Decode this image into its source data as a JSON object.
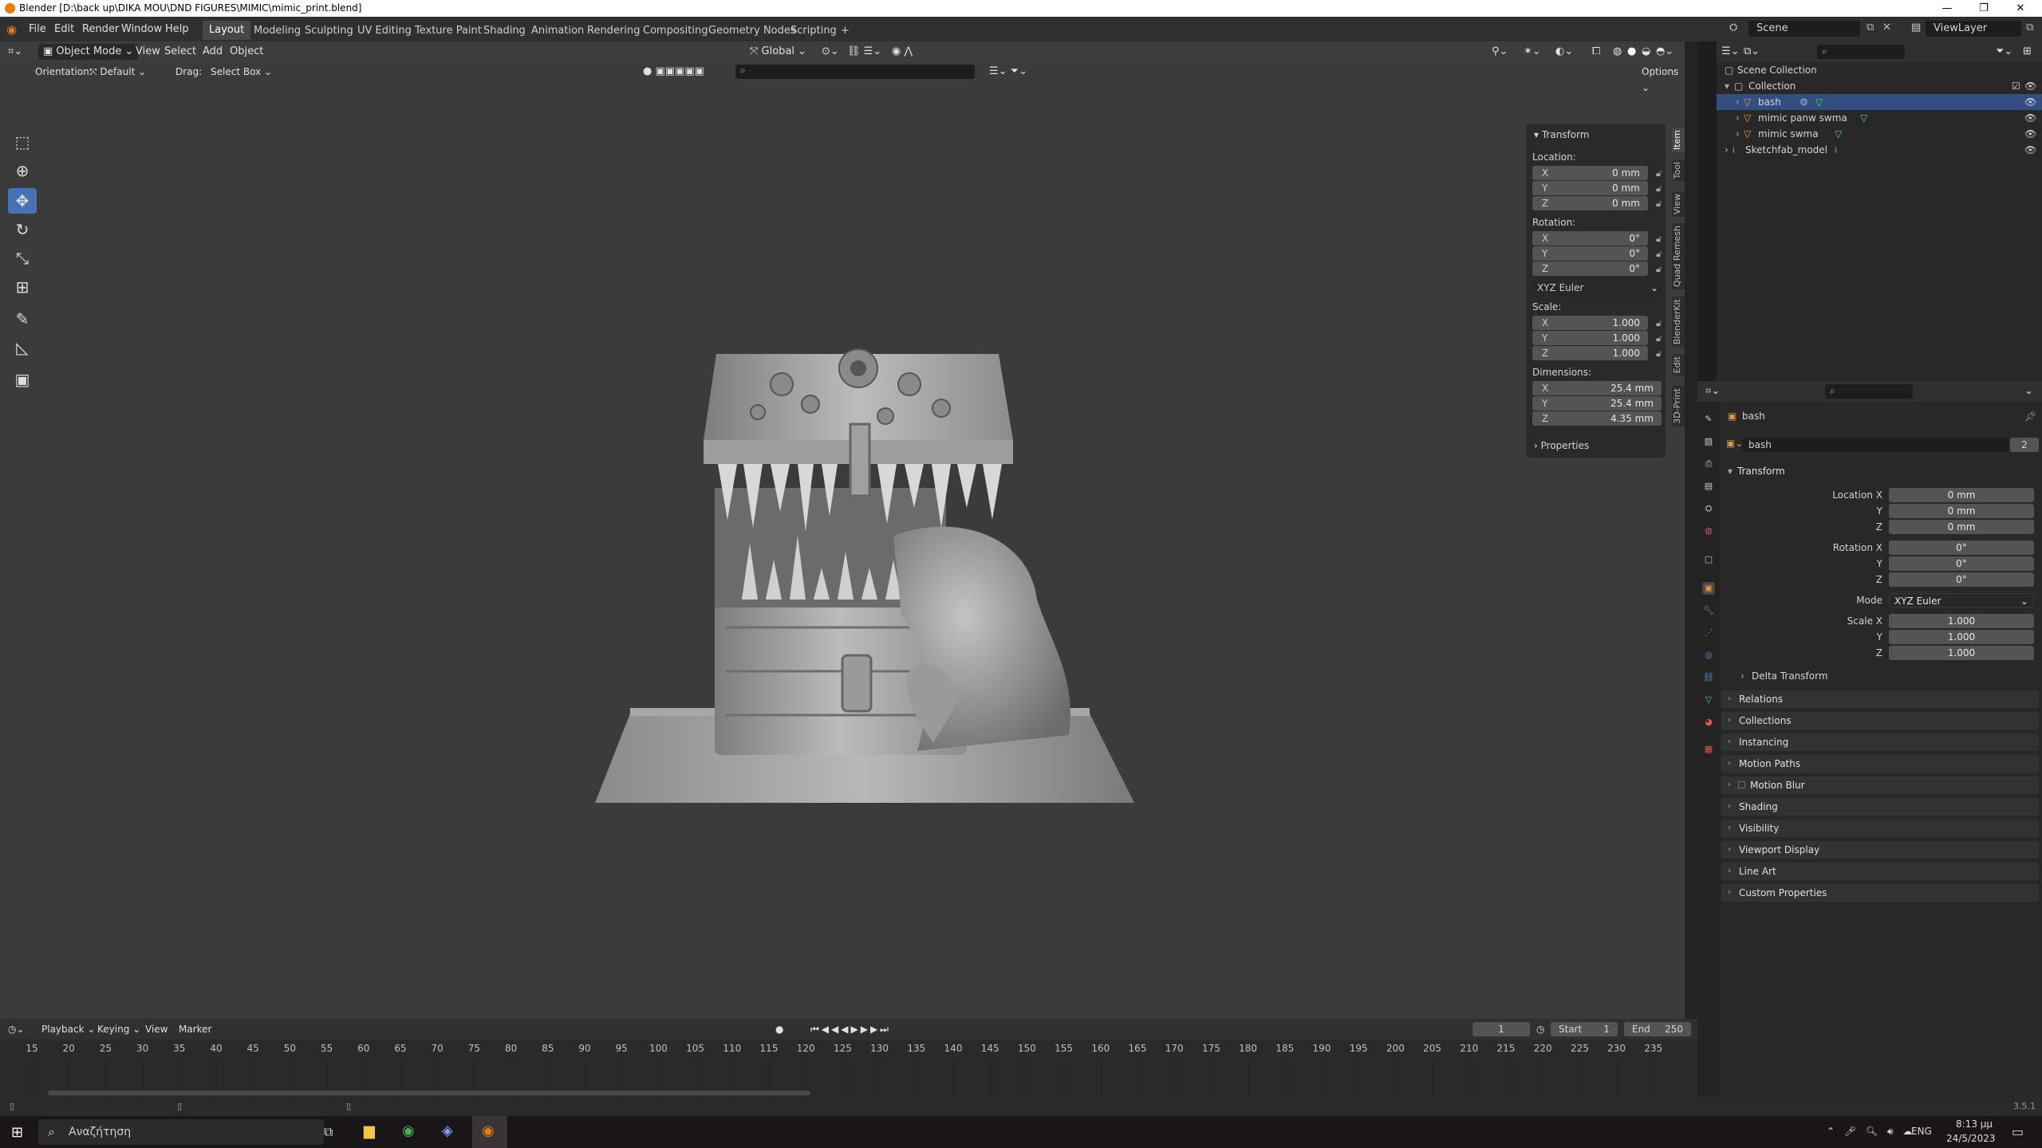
{
  "window": {
    "title": "Blender [D:\\back up\\DIKA MOU\\DND FIGURES\\MIMIC\\mimic_print.blend]",
    "minimize": "—",
    "maximize": "❐",
    "close": "✕"
  },
  "menus": [
    "File",
    "Edit",
    "Render",
    "Window",
    "Help"
  ],
  "workspaces": [
    "Layout",
    "Modeling",
    "Sculpting",
    "UV Editing",
    "Texture Paint",
    "Shading",
    "Animation",
    "Rendering",
    "Compositing",
    "Geometry Nodes",
    "Scripting",
    "+"
  ],
  "scene": {
    "name": "Scene",
    "view_layer": "ViewLayer"
  },
  "viewport_header": {
    "mode": "Object Mode",
    "menus": [
      "View",
      "Select",
      "Add",
      "Object"
    ],
    "transform_orientation": "Global",
    "orientation_label": "Orientation:",
    "orientation_value": "Default",
    "drag_label": "Drag:",
    "drag_value": "Select Box",
    "options": "Options"
  },
  "npanel": {
    "section": "Transform",
    "location_label": "Location:",
    "location": [
      {
        "axis": "X",
        "value": "0 mm"
      },
      {
        "axis": "Y",
        "value": "0 mm"
      },
      {
        "axis": "Z",
        "value": "0 mm"
      }
    ],
    "rotation_label": "Rotation:",
    "rotation": [
      {
        "axis": "X",
        "value": "0°"
      },
      {
        "axis": "Y",
        "value": "0°"
      },
      {
        "axis": "Z",
        "value": "0°"
      }
    ],
    "rotation_mode": "XYZ Euler",
    "scale_label": "Scale:",
    "scale": [
      {
        "axis": "X",
        "value": "1.000"
      },
      {
        "axis": "Y",
        "value": "1.000"
      },
      {
        "axis": "Z",
        "value": "1.000"
      }
    ],
    "dimensions_label": "Dimensions:",
    "dimensions": [
      {
        "axis": "X",
        "value": "25.4 mm"
      },
      {
        "axis": "Y",
        "value": "25.4 mm"
      },
      {
        "axis": "Z",
        "value": "4.35 mm"
      }
    ],
    "properties": "Properties",
    "tabs": [
      "Item",
      "Tool",
      "View",
      "Quad Remesh",
      "BlenderKit",
      "Edit",
      "3D-Print"
    ]
  },
  "outliner": {
    "items": [
      {
        "label": "Scene Collection"
      },
      {
        "label": "Collection"
      },
      {
        "label": "bash"
      },
      {
        "label": "mimic panw swma"
      },
      {
        "label": "mimic swma"
      },
      {
        "label": "Sketchfab_model"
      }
    ]
  },
  "properties": {
    "object_name": "bash",
    "datablock_name": "bash",
    "users": "2",
    "transform": "Transform",
    "location_x_label": "Location X",
    "location": [
      "0 mm",
      "0 mm",
      "0 mm"
    ],
    "rotation_x_label": "Rotation X",
    "rotation": [
      "0°",
      "0°",
      "0°"
    ],
    "mode_label": "Mode",
    "mode_value": "XYZ Euler",
    "scale_x_label": "Scale X",
    "scale": [
      "1.000",
      "1.000",
      "1.000"
    ],
    "y_label": "Y",
    "z_label": "Z",
    "delta_transform": "Delta Transform",
    "panels": [
      "Relations",
      "Collections",
      "Instancing",
      "Motion Paths",
      "Motion Blur",
      "Shading",
      "Visibility",
      "Viewport Display",
      "Line Art",
      "Custom Properties"
    ]
  },
  "timeline": {
    "menus": [
      "Playback",
      "Keying",
      "View",
      "Marker"
    ],
    "current_frame": "1",
    "start_label": "Start",
    "start": "1",
    "end_label": "End",
    "end": "250",
    "ticks": [
      "15",
      "20",
      "25",
      "30",
      "35",
      "40",
      "45",
      "50",
      "55",
      "60",
      "65",
      "70",
      "75",
      "80",
      "85",
      "90",
      "95",
      "100",
      "105",
      "110",
      "115",
      "120",
      "125",
      "130",
      "135",
      "140",
      "145",
      "150",
      "155",
      "160",
      "165",
      "170",
      "175",
      "180",
      "185",
      "190",
      "195",
      "200",
      "205",
      "210",
      "215",
      "220",
      "225",
      "230",
      "235"
    ]
  },
  "status": {
    "version": "3.5.1"
  },
  "taskbar": {
    "search_placeholder": "Αναζήτηση",
    "language": "ENG",
    "time": "8:13 μμ",
    "date": "24/5/2023"
  },
  "colors": {
    "accent": "#4772b3",
    "blender_orange": "#e87d0d"
  }
}
